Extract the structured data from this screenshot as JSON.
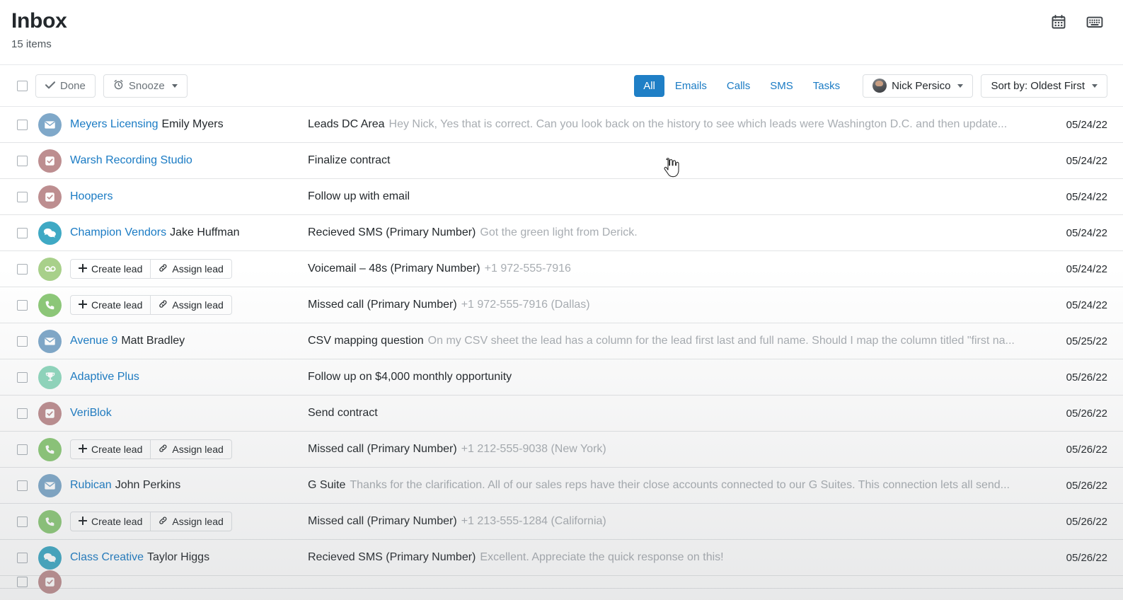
{
  "header": {
    "title": "Inbox",
    "item_count": "15 items",
    "icons": [
      {
        "name": "calendar-icon"
      },
      {
        "name": "keyboard-icon"
      }
    ]
  },
  "toolbar": {
    "select_all_checkbox": "",
    "done_label": "Done",
    "snooze_label": "Snooze",
    "tabs": [
      {
        "label": "All",
        "active": true
      },
      {
        "label": "Emails",
        "active": false
      },
      {
        "label": "Calls",
        "active": false
      },
      {
        "label": "SMS",
        "active": false
      },
      {
        "label": "Tasks",
        "active": false
      }
    ],
    "user_filter": "Nick Persico",
    "sort_label": "Sort by: Oldest First"
  },
  "lead_actions": {
    "create_label": "Create lead",
    "assign_label": "Assign lead"
  },
  "colors": {
    "accent": "#1f7fc6",
    "link": "#1a7bc4",
    "email_avatar": "#7fa8c9",
    "task_avatar": "#bd8e90",
    "sms_avatar": "#3fa9c4",
    "voicemail_avatar": "#a8d08a",
    "call_avatar": "#8cc878",
    "opportunity_avatar": "#8fd7bd"
  },
  "rows": [
    {
      "type": "email",
      "icon": "envelope-icon",
      "org": "Meyers Licensing",
      "person": "Emily Myers",
      "subject": "Leads DC Area",
      "preview": "Hey Nick, Yes that is correct. Can you look back on the history to see which leads were Washington D.C. and then update...",
      "date": "05/24/22"
    },
    {
      "type": "task",
      "icon": "task-check-icon",
      "org": "Warsh Recording Studio",
      "person": "",
      "subject": "Finalize contract",
      "preview": "",
      "date": "05/24/22"
    },
    {
      "type": "task",
      "icon": "task-check-icon",
      "org": "Hoopers",
      "person": "",
      "subject": "Follow up with email",
      "preview": "",
      "date": "05/24/22"
    },
    {
      "type": "sms",
      "icon": "chat-bubble-icon",
      "org": "Champion Vendors",
      "person": "Jake Huffman",
      "subject": "Recieved SMS (Primary Number)",
      "preview": "Got the green light from Derick.",
      "date": "05/24/22"
    },
    {
      "type": "voicemail",
      "icon": "voicemail-icon",
      "org": "",
      "person": "",
      "has_lead_buttons": true,
      "subject": "Voicemail – 48s (Primary Number)",
      "preview": "+1 972-555-7916",
      "date": "05/24/22"
    },
    {
      "type": "call",
      "icon": "phone-icon",
      "org": "",
      "person": "",
      "has_lead_buttons": true,
      "subject": "Missed call (Primary Number)",
      "preview": "+1 972-555-7916 (Dallas)",
      "date": "05/24/22"
    },
    {
      "type": "email",
      "icon": "envelope-icon",
      "org": "Avenue 9",
      "person": "Matt Bradley",
      "subject": "CSV mapping question",
      "preview": "On my CSV sheet the lead has a column for the lead first last and full name. Should I map the column titled \"first na...",
      "date": "05/25/22"
    },
    {
      "type": "opportunity",
      "icon": "trophy-icon",
      "org": "Adaptive Plus",
      "person": "",
      "subject": "Follow up on $4,000 monthly opportunity",
      "preview": "",
      "date": "05/26/22"
    },
    {
      "type": "task",
      "icon": "task-check-icon",
      "org": "VeriBlok",
      "person": "",
      "subject": "Send contract",
      "preview": "",
      "date": "05/26/22"
    },
    {
      "type": "call",
      "icon": "phone-icon",
      "org": "",
      "person": "",
      "has_lead_buttons": true,
      "subject": "Missed call (Primary Number)",
      "preview": "+1 212-555-9038 (New York)",
      "date": "05/26/22"
    },
    {
      "type": "email",
      "icon": "envelope-icon",
      "org": "Rubican",
      "person": "John Perkins",
      "subject": "G Suite",
      "preview": "Thanks for the clarification. All of our sales reps have their close accounts connected to our G Suites. This connection lets all send...",
      "date": "05/26/22"
    },
    {
      "type": "call",
      "icon": "phone-icon",
      "org": "",
      "person": "",
      "has_lead_buttons": true,
      "subject": "Missed call (Primary Number)",
      "preview": "+1 213-555-1284 (California)",
      "date": "05/26/22"
    },
    {
      "type": "sms",
      "icon": "chat-bubble-icon",
      "org": "Class Creative",
      "person": "Taylor Higgs",
      "subject": "Recieved SMS (Primary Number)",
      "preview": "Excellent. Appreciate the quick response on this!",
      "date": "05/26/22"
    },
    {
      "type": "task",
      "icon": "task-check-icon",
      "org": "",
      "person": "",
      "subject": "",
      "preview": "",
      "date": "",
      "partial": true
    }
  ]
}
